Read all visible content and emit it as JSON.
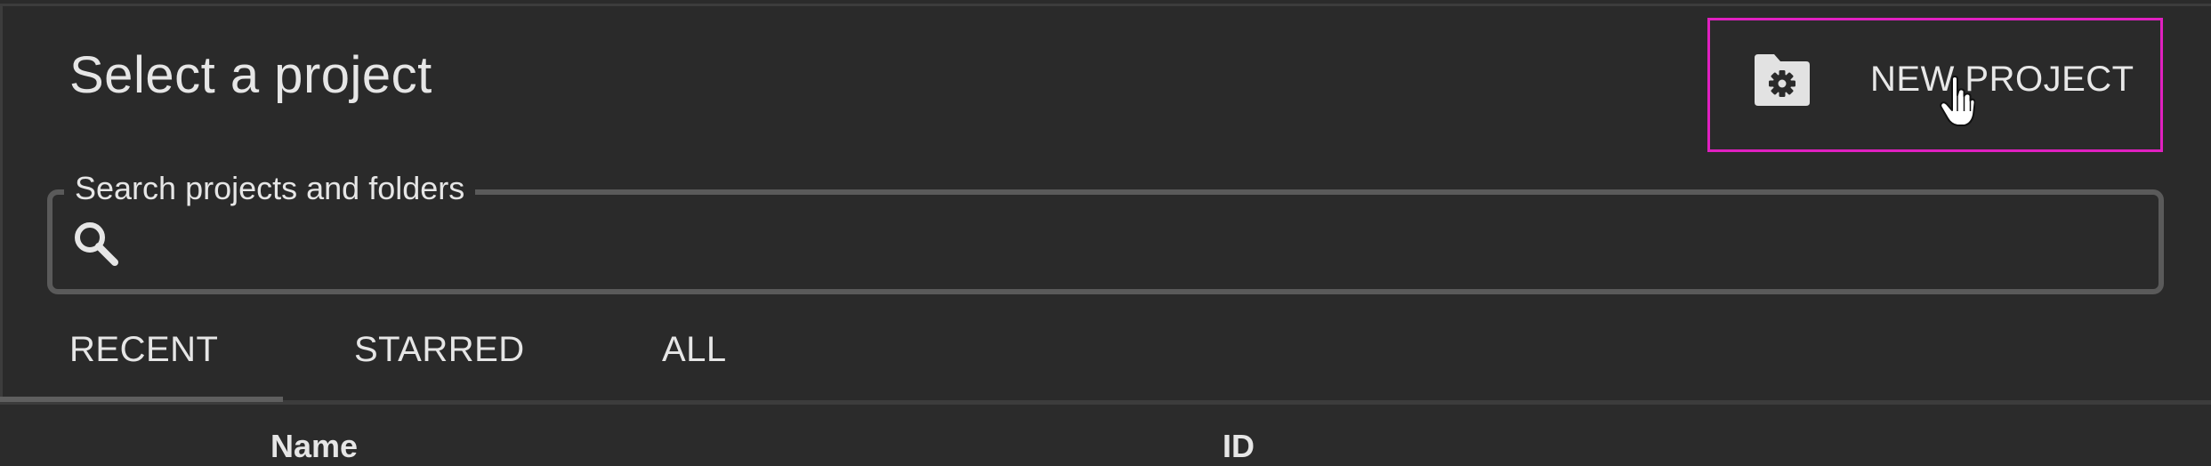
{
  "dialog": {
    "title": "Select a project",
    "new_project": {
      "label": "NEW PROJECT",
      "icon": "folder-settings-icon"
    }
  },
  "search": {
    "label": "Search projects and folders",
    "value": "",
    "placeholder": "",
    "icon": "search-icon"
  },
  "tabs": [
    {
      "label": "RECENT",
      "selected": true
    },
    {
      "label": "STARRED",
      "selected": false
    },
    {
      "label": "ALL",
      "selected": false
    }
  ],
  "table": {
    "columns": [
      "Name",
      "ID"
    ]
  },
  "colors": {
    "background": "#2a2a2a",
    "text": "#e6e6e6",
    "highlight_border": "#e020c0",
    "field_border": "#5a5a5a"
  }
}
